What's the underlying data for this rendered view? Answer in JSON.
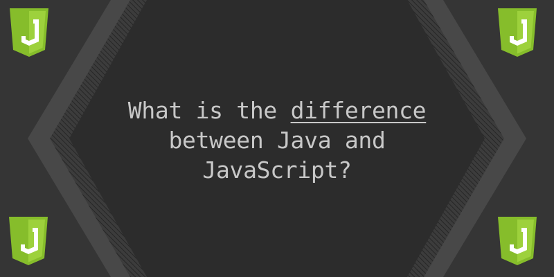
{
  "headline": {
    "line1_before": "What is the ",
    "line1_underlined": "difference",
    "line2": "between Java and",
    "line3": "JavaScript?"
  },
  "badge": {
    "glyph": "J",
    "icon": "javascript-shield-icon"
  },
  "colors": {
    "background": "#353535",
    "inner_panel": "#2c2c2c",
    "outer_band": "#484848",
    "hatch": "#262626",
    "text": "#c8c8c8",
    "badge_green": "#86bd2b",
    "badge_green_light": "#9dd13c",
    "badge_white": "#ffffff"
  }
}
